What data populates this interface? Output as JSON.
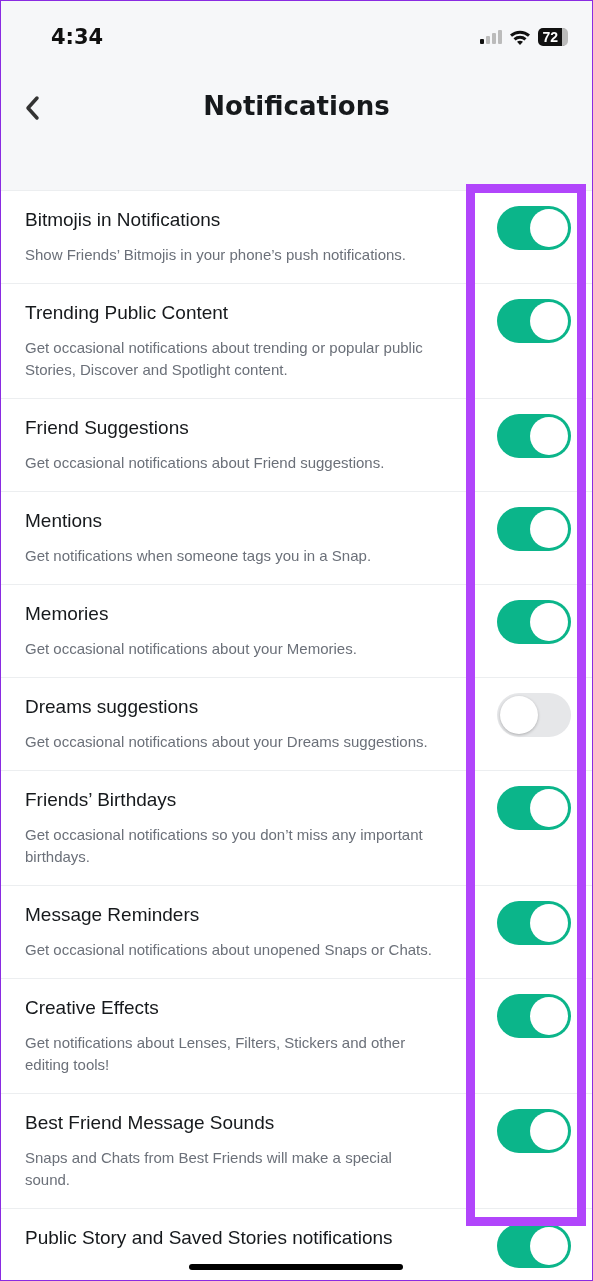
{
  "status_bar": {
    "time": "4:34",
    "battery": "72"
  },
  "header": {
    "title": "Notifications"
  },
  "settings": [
    {
      "title": "Bitmojis in Notifications",
      "description": "Show Friends’ Bitmojis in your phone’s push notifications.",
      "on": true
    },
    {
      "title": "Trending Public Content",
      "description": "Get occasional notifications about trending or popular public Stories, Discover and Spotlight content.",
      "on": true
    },
    {
      "title": "Friend Suggestions",
      "description": "Get occasional notifications about Friend suggestions.",
      "on": true
    },
    {
      "title": "Mentions",
      "description": "Get notifications when someone tags you in a Snap.",
      "on": true
    },
    {
      "title": "Memories",
      "description": "Get occasional notifications about your Memories.",
      "on": true
    },
    {
      "title": "Dreams suggestions",
      "description": "Get occasional notifications about your Dreams suggestions.",
      "on": false
    },
    {
      "title": "Friends’ Birthdays",
      "description": "Get occasional notifications so you don’t miss any important birthdays.",
      "on": true
    },
    {
      "title": "Message Reminders",
      "description": "Get occasional notifications about unopened Snaps or Chats.",
      "on": true
    },
    {
      "title": "Creative Effects",
      "description": "Get notifications about Lenses, Filters, Stickers and other editing tools!",
      "on": true
    },
    {
      "title": "Best Friend Message Sounds",
      "description": "Snaps and Chats from Best Friends will make a special sound.",
      "on": true
    },
    {
      "title": "Public Story and Saved Stories notifications",
      "on": true
    }
  ]
}
